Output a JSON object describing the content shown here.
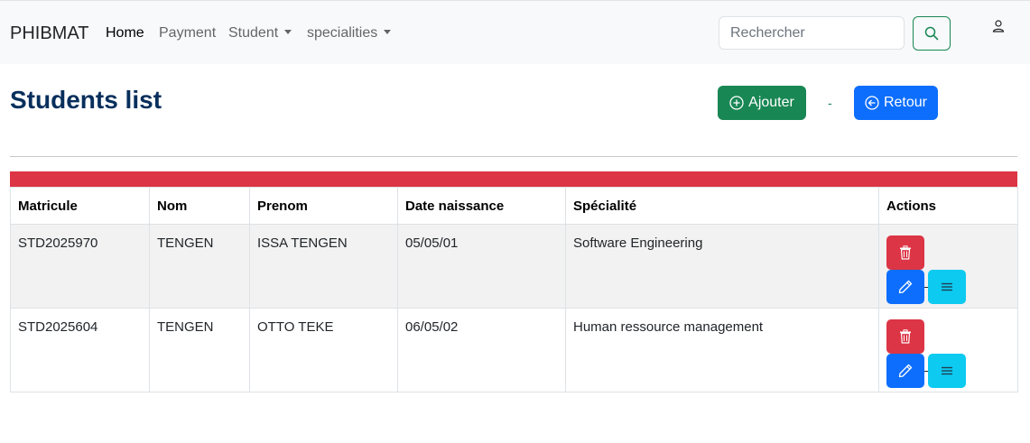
{
  "navbar": {
    "brand": "PHIBMAT",
    "links": [
      {
        "label": "Home"
      },
      {
        "label": "Payment"
      },
      {
        "label": "Student"
      },
      {
        "label": "specialities"
      }
    ],
    "search_placeholder": "Rechercher",
    "search_icon": "search-icon",
    "user_icon": "person-icon"
  },
  "page": {
    "title": "Students list",
    "add_label": "Ajouter",
    "add_icon": "plus-circle-icon",
    "separator": "-",
    "back_label": "Retour",
    "back_icon": "arrow-left-circle-icon"
  },
  "table": {
    "headers": [
      "Matricule",
      "Nom",
      "Prenom",
      "Date naissance",
      "Spécialité",
      "Actions"
    ],
    "rows": [
      {
        "matricule": "STD2025970",
        "nom": "TENGEN",
        "prenom": "ISSA TENGEN",
        "date": "05/05/01",
        "specialite": "Software Engineering"
      },
      {
        "matricule": "STD2025604",
        "nom": "TENGEN",
        "prenom": "OTTO TEKE",
        "date": "06/05/02",
        "specialite": "Human ressource management"
      }
    ]
  },
  "colors": {
    "navbar_bg": "#f8f9fa",
    "title": "#082f5c",
    "success": "#198754",
    "primary": "#0d6efd",
    "danger": "#dc3545",
    "info": "#0dcaf0"
  }
}
